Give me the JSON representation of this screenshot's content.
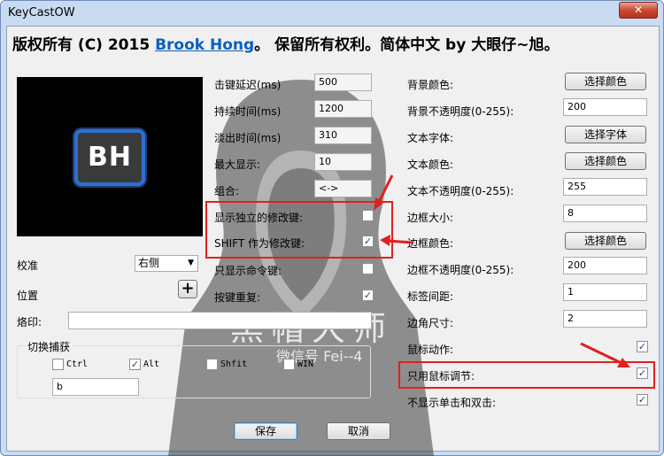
{
  "window": {
    "title": "KeyCastOW",
    "close_symbol": "✕"
  },
  "header": {
    "prefix": "版权所有 (C) 2015 ",
    "author": "Brook Hong",
    "suffix": "。 保留所有权利。简体中文 by 大眼仔~旭。"
  },
  "logo": {
    "text": "BH"
  },
  "left": {
    "calibration_label": "校准",
    "calibration_value": "右侧",
    "position_label": "位置",
    "position_button": "+",
    "branding_label": "烙印:",
    "branding_value": "",
    "switch_group_title": "切换捕获",
    "ctrl_label": "Ctrl",
    "ctrl_checked": false,
    "alt_label": "Alt",
    "alt_checked": true,
    "shift_label": "Shfit",
    "shift_checked": false,
    "win_label": "WIN",
    "win_checked": false,
    "key_value": "b"
  },
  "middle": {
    "keystroke_delay_label": "击键延迟(ms)",
    "keystroke_delay_value": "500",
    "duration_label": "持续时间(ms)",
    "duration_value": "1200",
    "fade_label": "淡出时间(ms)",
    "fade_value": "310",
    "max_display_label": "最大显示:",
    "max_display_value": "10",
    "combo_label": "组合:",
    "combo_value": "<->",
    "show_modifiers_label": "显示独立的修改键:",
    "show_modifiers_checked": false,
    "shift_modifier_label": "SHIFT 作为修改键:",
    "shift_modifier_checked": true,
    "only_commands_label": "只显示命令键:",
    "only_commands_checked": false,
    "key_repeat_label": "按键重复:",
    "key_repeat_checked": true
  },
  "right": {
    "bg_color_label": "背景颜色:",
    "bg_color_button": "选择颜色",
    "bg_opacity_label": "背景不透明度(0-255):",
    "bg_opacity_value": "200",
    "text_font_label": "文本字体:",
    "text_font_button": "选择字体",
    "text_color_label": "文本颜色:",
    "text_color_button": "选择颜色",
    "text_opacity_label": "文本不透明度(0-255):",
    "text_opacity_value": "255",
    "border_size_label": "边框大小:",
    "border_size_value": "8",
    "border_color_label": "边框颜色:",
    "border_color_button": "选择颜色",
    "border_opacity_label": "边框不透明度(0-255):",
    "border_opacity_value": "200",
    "label_spacing_label": "标签间距:",
    "label_spacing_value": "1",
    "corner_size_label": "边角尺寸:",
    "corner_size_value": "2",
    "mouse_action_label": "鼠标动作:",
    "mouse_action_checked": true,
    "mouse_wheel_only_label": "只用鼠标调节:",
    "mouse_wheel_only_checked": true,
    "no_click_label": "不显示单击和双击:",
    "no_click_checked": true
  },
  "footer": {
    "save": "保存",
    "cancel": "取消"
  },
  "watermark": {
    "title": "黑帽大师",
    "subtitle": "微信号 Fei--4"
  },
  "colors": {
    "annotation_red": "#e02020",
    "link_blue": "#0b5fbd",
    "logo_border": "#2f6fcf"
  }
}
